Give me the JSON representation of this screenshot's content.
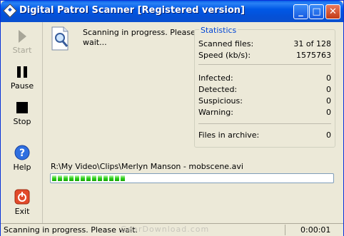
{
  "window": {
    "title": "Digital Patrol Scanner [Registered version]"
  },
  "titlebar_buttons": {
    "minimize": "_",
    "maximize": "□",
    "close": "✕"
  },
  "sidebar": {
    "items": [
      {
        "label": "Start",
        "icon": "play-icon",
        "enabled": false
      },
      {
        "label": "Pause",
        "icon": "pause-icon",
        "enabled": true
      },
      {
        "label": "Stop",
        "icon": "stop-icon",
        "enabled": true
      },
      {
        "label": "Help",
        "icon": "help-icon",
        "enabled": true
      },
      {
        "label": "Exit",
        "icon": "exit-icon",
        "enabled": true
      }
    ]
  },
  "scan": {
    "message": "Scanning in progress. Please wait...",
    "current_file": "R:\\My Video\\Clips\\Merlyn Manson - mobscene.avi",
    "progress_fraction": 0.27
  },
  "statistics": {
    "title": "Statistics",
    "rows": [
      {
        "label": "Scanned files:",
        "value": "31 of 128"
      },
      {
        "label": "Speed (kb/s):",
        "value": "1575763"
      },
      {
        "label": "Infected:",
        "value": "0"
      },
      {
        "label": "Detected:",
        "value": "0"
      },
      {
        "label": "Suspicious:",
        "value": "0"
      },
      {
        "label": "Warning:",
        "value": "0"
      },
      {
        "label": "Files in archive:",
        "value": "0"
      }
    ]
  },
  "statusbar": {
    "text": "Scanning in progress. Please wait.",
    "elapsed": "0:00:01"
  },
  "watermark": "GearDownload.com",
  "colors": {
    "accent": "#0058e6",
    "progress": "#2ed11b",
    "stats_title": "#0046d5"
  }
}
